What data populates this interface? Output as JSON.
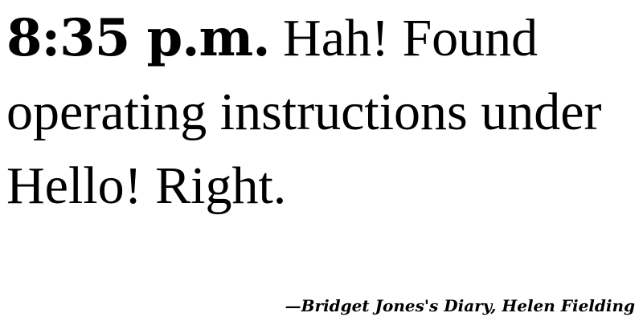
{
  "quote": {
    "time": "8:35 p.m.",
    "text": " Hah! Found operating instructions under Hello! Right."
  },
  "attribution": {
    "text": "—Bridget Jones's Diary, Helen Fielding"
  }
}
